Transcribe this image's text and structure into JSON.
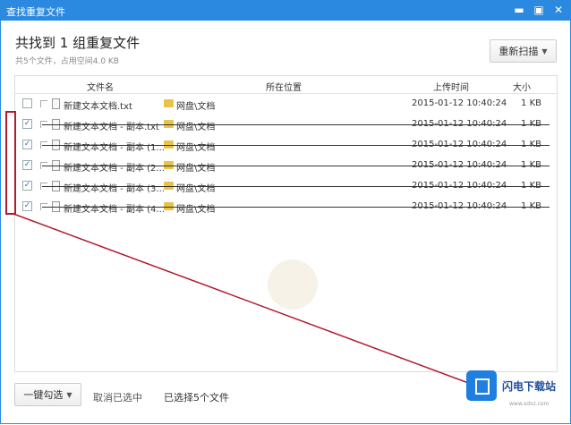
{
  "window": {
    "title": "查找重复文件",
    "controls": [
      "▬",
      "▣",
      "✕"
    ]
  },
  "header": {
    "title": "共找到 1 组重复文件",
    "subtitle": "共5个文件，占用空间4.0 KB",
    "rescan_label": "重新扫描"
  },
  "table": {
    "columns": [
      "文件名",
      "所在位置",
      "上传时间",
      "大小"
    ],
    "rows": [
      {
        "name": "新建文本文档.txt",
        "location": "网盘\\文档",
        "time": "2015-01-12 10:40:24",
        "size": "1 KB",
        "checked": false
      },
      {
        "name": "新建文本文档 - 副本.txt",
        "location": "网盘\\文档",
        "time": "2015-01-12 10:40:24",
        "size": "1 KB",
        "checked": true
      },
      {
        "name": "新建文本文档 - 副本 (1...",
        "location": "网盘\\文档",
        "time": "2015-01-12 10:40:24",
        "size": "1 KB",
        "checked": true
      },
      {
        "name": "新建文本文档 - 副本 (2...",
        "location": "网盘\\文档",
        "time": "2015-01-12 10:40:24",
        "size": "1 KB",
        "checked": true
      },
      {
        "name": "新建文本文档 - 副本 (3...",
        "location": "网盘\\文档",
        "time": "2015-01-12 10:40:24",
        "size": "1 KB",
        "checked": true
      },
      {
        "name": "新建文本文档 - 副本 (4...",
        "location": "网盘\\文档",
        "time": "2015-01-12 10:40:24",
        "size": "1 KB",
        "checked": true
      }
    ]
  },
  "footer": {
    "select_label": "一键勾选",
    "cancel_label": "取消已选中",
    "selected_info": "已选择5个文件"
  },
  "brand": {
    "name": "闪电下载站",
    "url": "www.sdxz.com"
  },
  "colors": {
    "accent": "#2b8ae0",
    "highlight": "#b01c2e",
    "checkbox": "#2b6ed6"
  }
}
